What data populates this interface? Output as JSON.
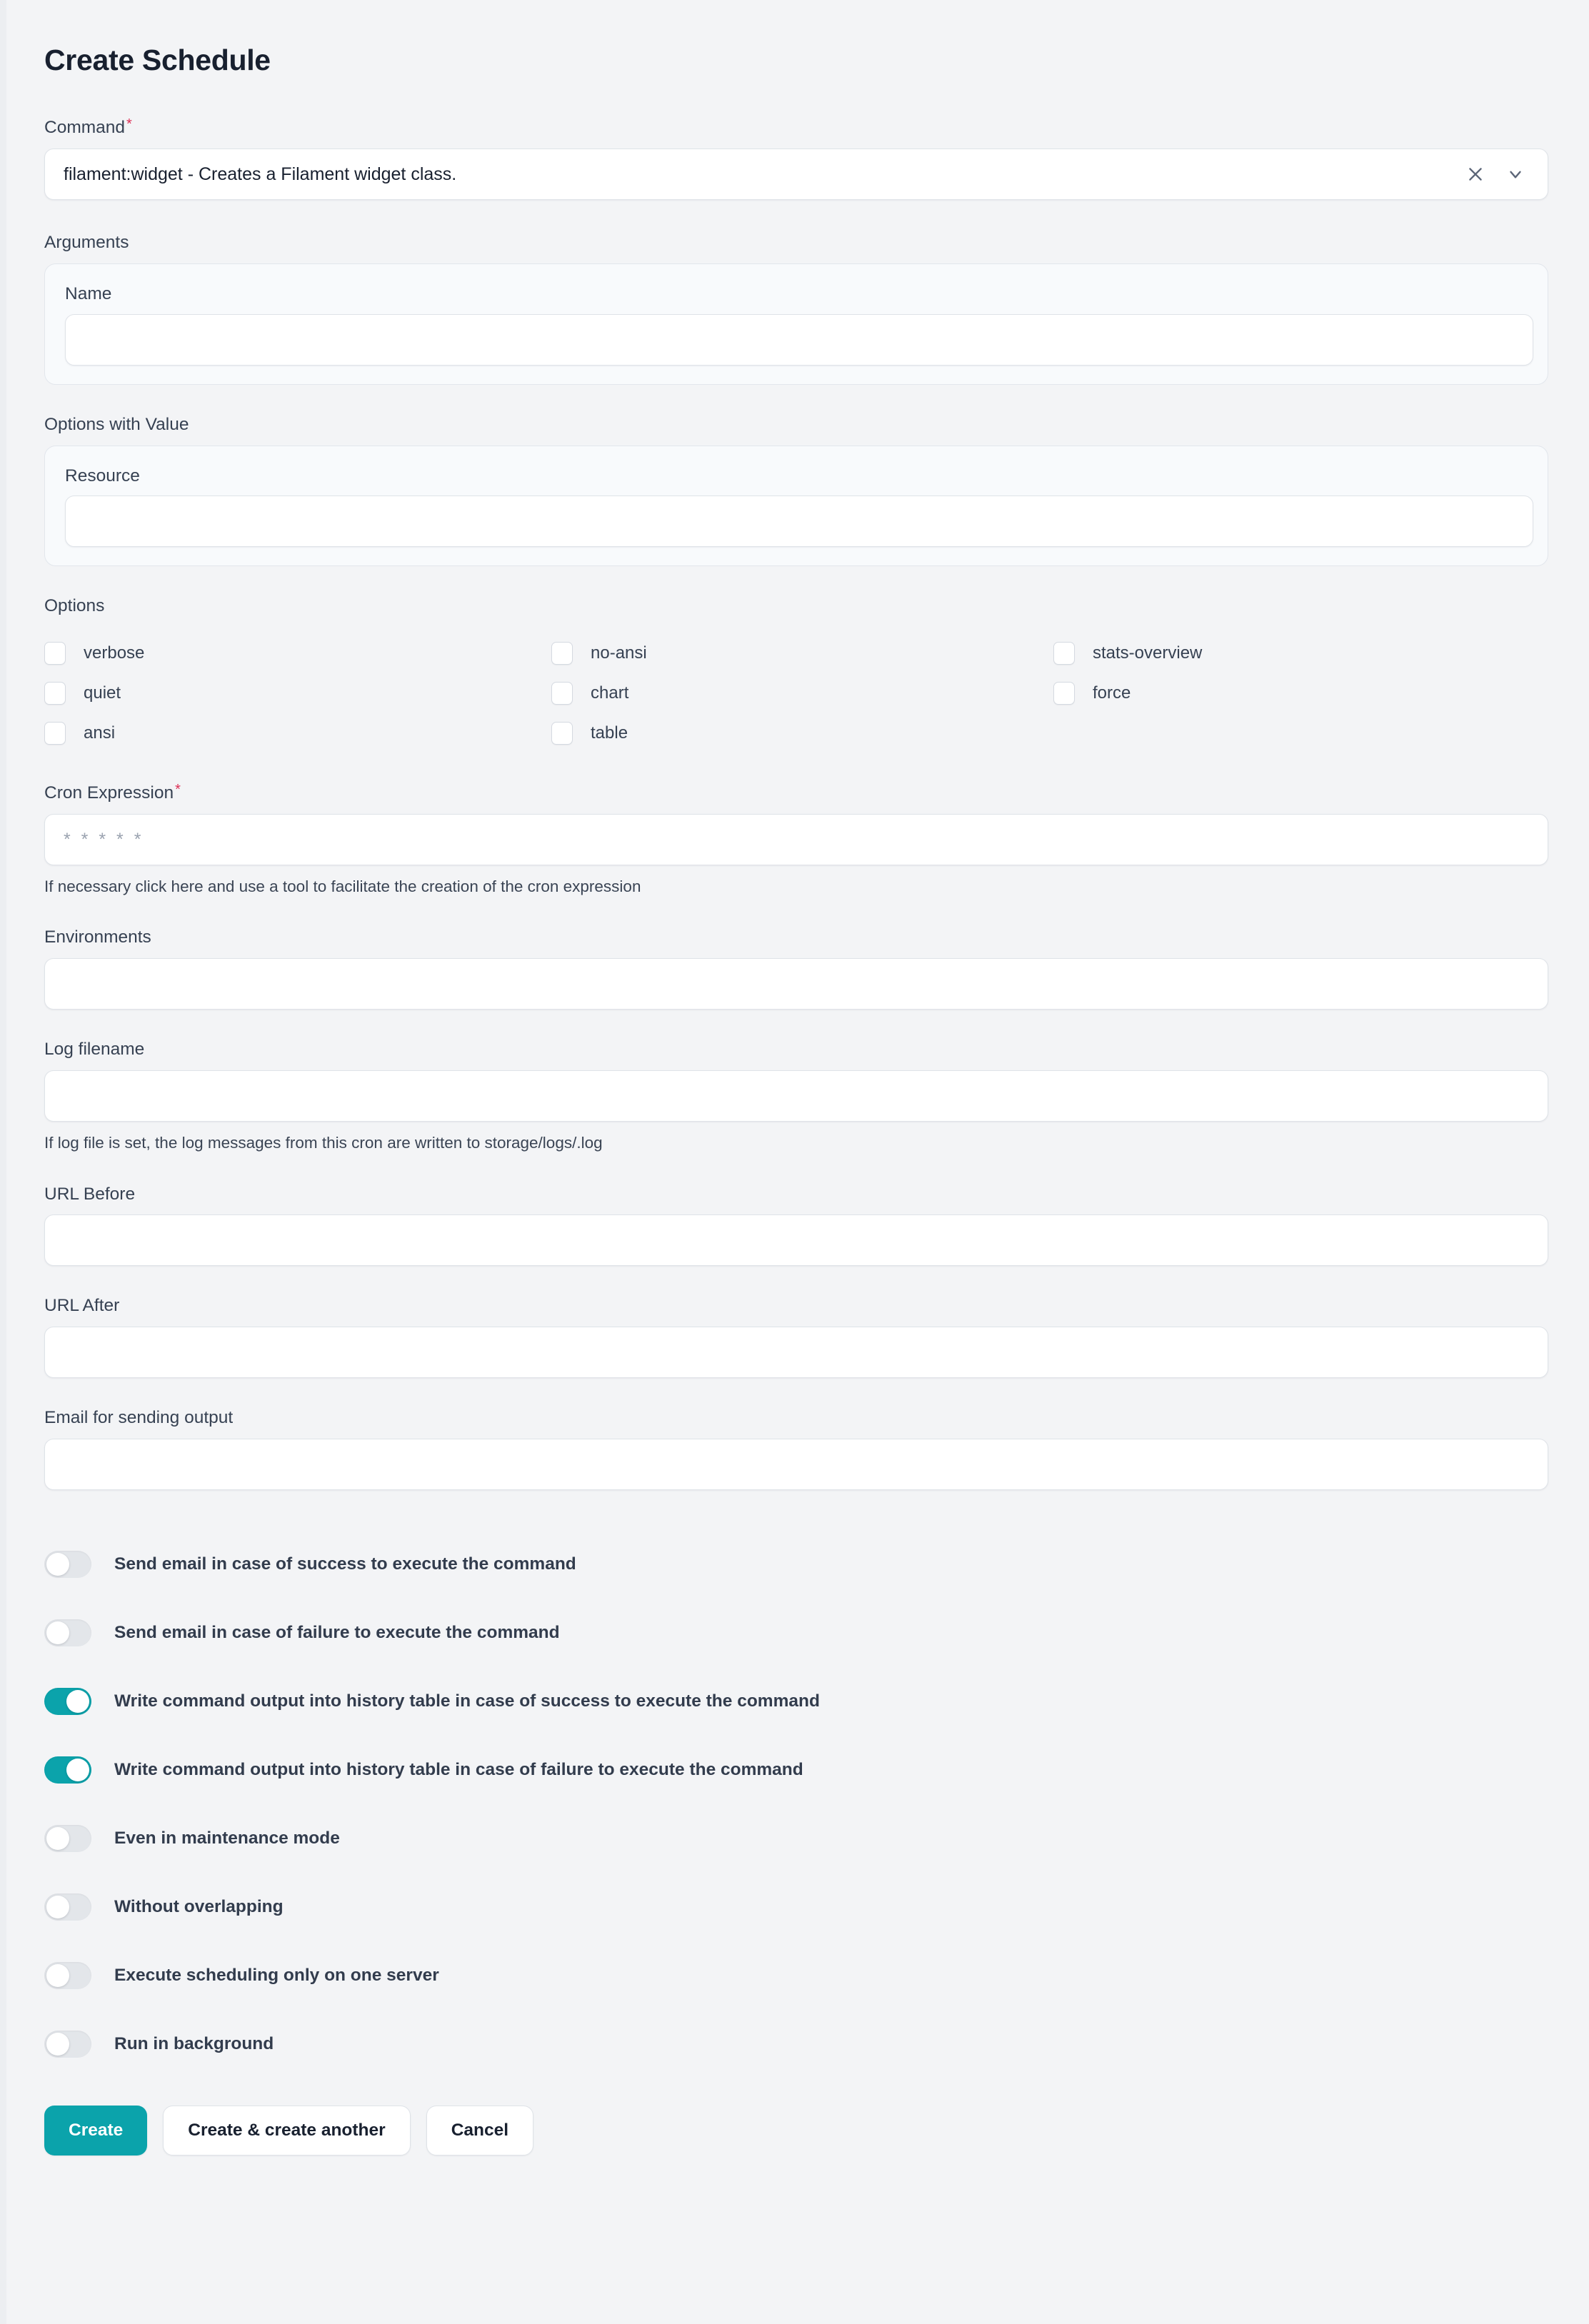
{
  "page": {
    "title": "Create Schedule"
  },
  "fields": {
    "command": {
      "label": "Command",
      "required_marker": "*",
      "value": "filament:widget - Creates a Filament widget class.",
      "clear_icon": "close-icon",
      "dropdown_icon": "chevron-down-icon"
    },
    "arguments": {
      "label": "Arguments",
      "items": [
        {
          "label": "Name",
          "value": ""
        }
      ]
    },
    "options_with_value": {
      "label": "Options with Value",
      "items": [
        {
          "label": "Resource",
          "value": ""
        }
      ]
    },
    "options": {
      "label": "Options",
      "items": [
        {
          "label": "verbose",
          "checked": false
        },
        {
          "label": "no-ansi",
          "checked": false
        },
        {
          "label": "stats-overview",
          "checked": false
        },
        {
          "label": "quiet",
          "checked": false
        },
        {
          "label": "chart",
          "checked": false
        },
        {
          "label": "force",
          "checked": false
        },
        {
          "label": "ansi",
          "checked": false
        },
        {
          "label": "table",
          "checked": false
        },
        {
          "label": "",
          "checked": false
        }
      ]
    },
    "cron_expression": {
      "label": "Cron Expression",
      "required_marker": "*",
      "value": "",
      "placeholder": "* * * * *",
      "helper": "If necessary click here and use a tool to facilitate the creation of the cron expression"
    },
    "environments": {
      "label": "Environments",
      "value": ""
    },
    "log_filename": {
      "label": "Log filename",
      "value": "",
      "helper": "If log file is set, the log messages from this cron are written to storage/logs/.log"
    },
    "url_before": {
      "label": "URL Before",
      "value": ""
    },
    "url_after": {
      "label": "URL After",
      "value": ""
    },
    "email_output": {
      "label": "Email for sending output",
      "value": ""
    }
  },
  "toggles": [
    {
      "label": "Send email in case of success to execute the command",
      "on": false
    },
    {
      "label": "Send email in case of failure to execute the command",
      "on": false
    },
    {
      "label": "Write command output into history table in case of success to execute the command",
      "on": true
    },
    {
      "label": "Write command output into history table in case of failure to execute the command",
      "on": true
    },
    {
      "label": "Even in maintenance mode",
      "on": false
    },
    {
      "label": "Without overlapping",
      "on": false
    },
    {
      "label": "Execute scheduling only on one server",
      "on": false
    },
    {
      "label": "Run in background",
      "on": false
    }
  ],
  "actions": {
    "create": "Create",
    "create_another": "Create & create another",
    "cancel": "Cancel"
  },
  "colors": {
    "accent": "#0ba3ab",
    "required": "#dc2f55",
    "background": "#f3f4f6",
    "text": "#18202f"
  }
}
